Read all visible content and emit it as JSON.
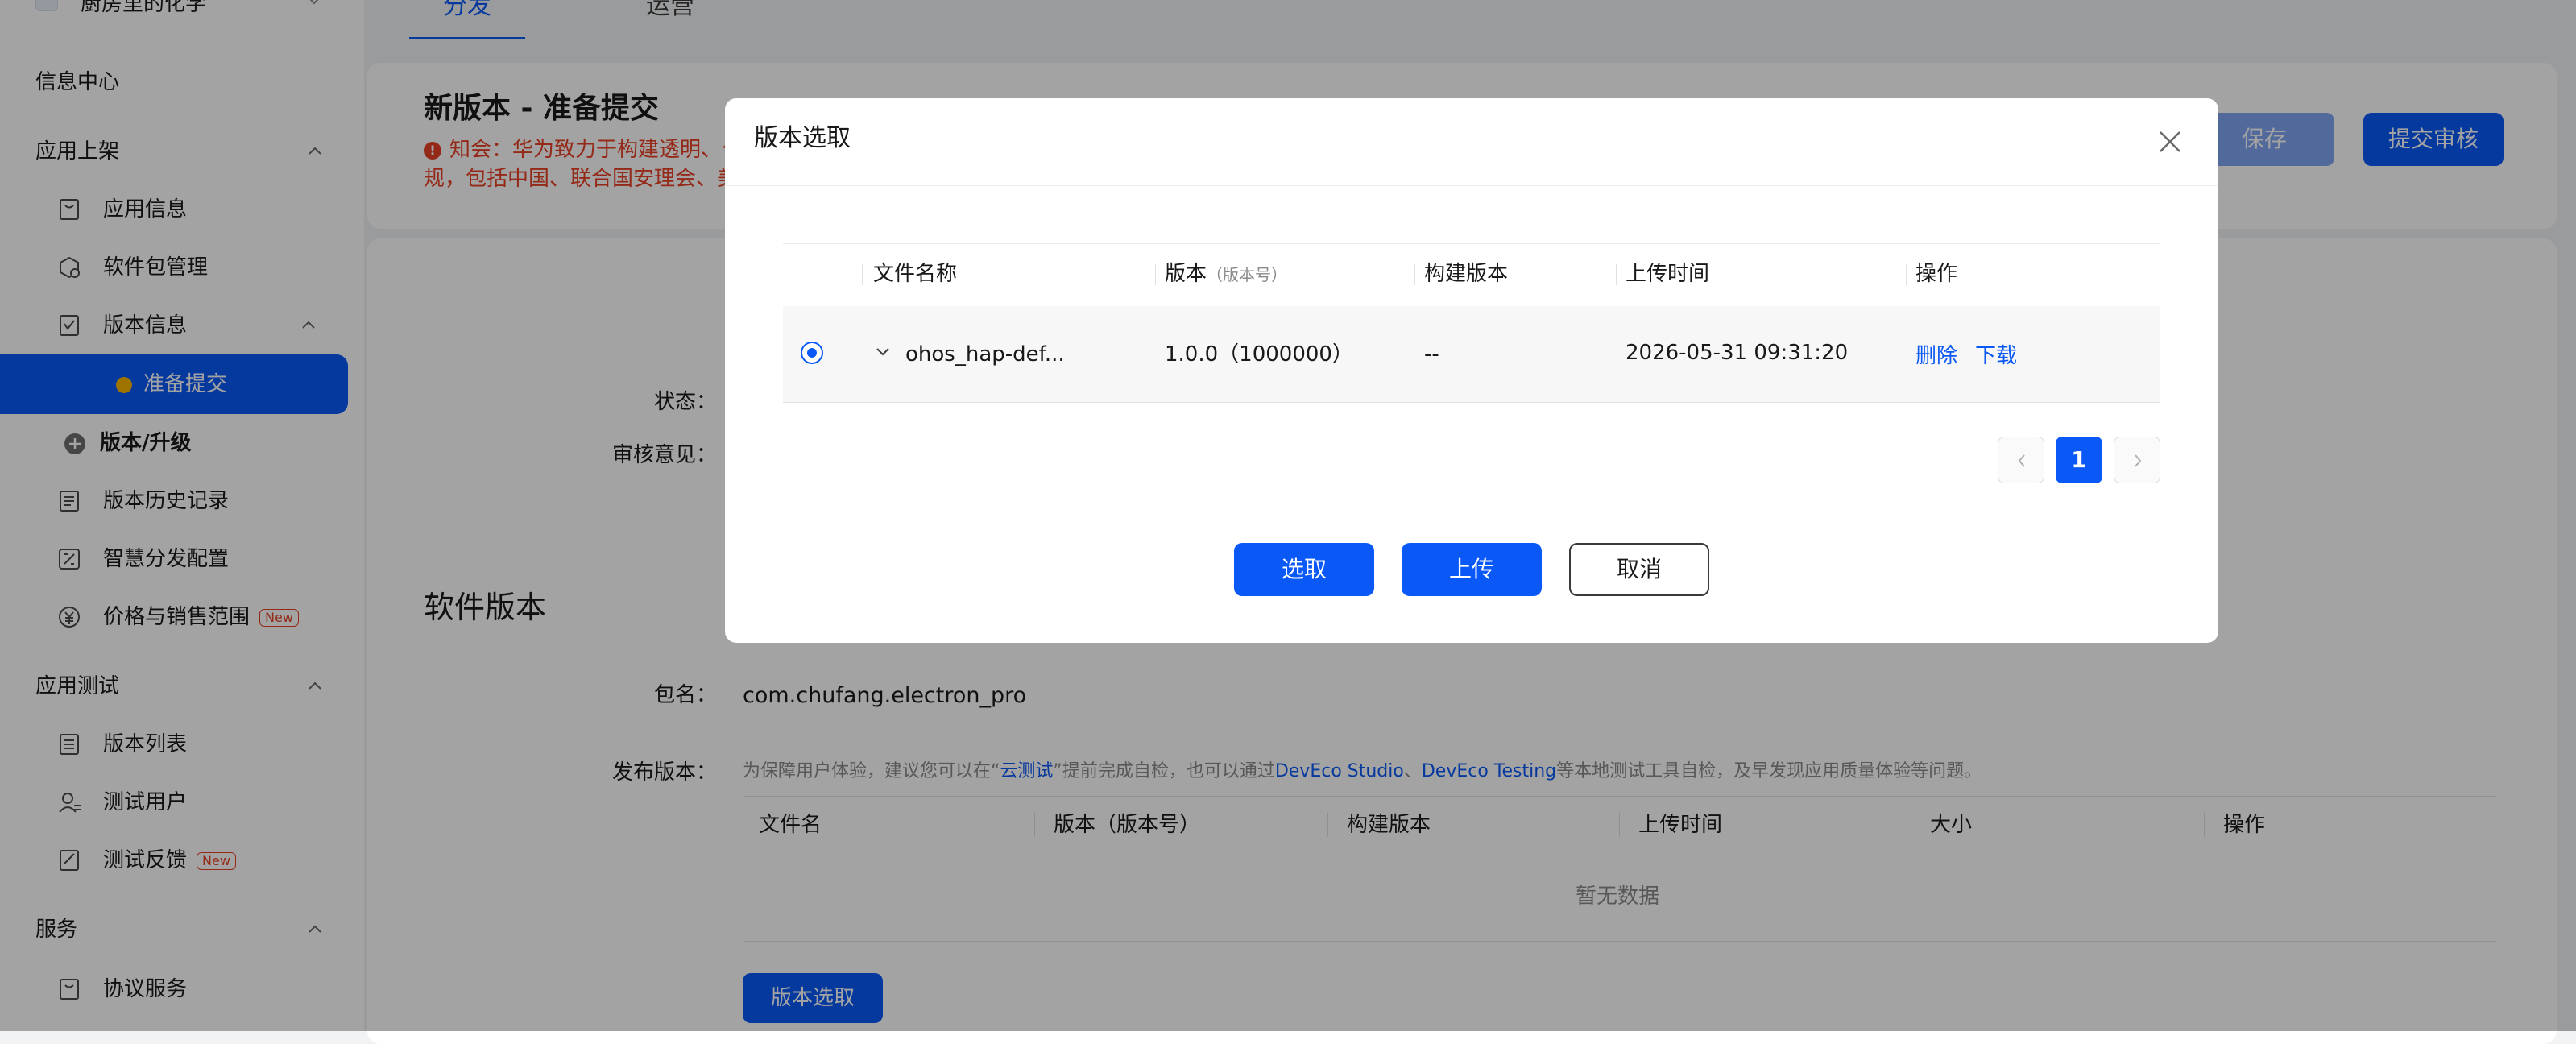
{
  "sidebar": {
    "app_name": "厨房里的化学",
    "info_center": "信息中心",
    "groups": {
      "publish": "应用上架",
      "test": "应用测试",
      "service": "服务"
    },
    "items": {
      "app_info": "应用信息",
      "package_mgmt": "软件包管理",
      "version_info": "版本信息",
      "prepare_submit": "准备提交",
      "version_upgrade": "版本/升级",
      "version_history": "版本历史记录",
      "smart_distribution": "智慧分发配置",
      "price_sales": "价格与销售范围",
      "version_list": "版本列表",
      "test_users": "测试用户",
      "test_feedback": "测试反馈",
      "agreement_service": "协议服务"
    },
    "new_badge": "New"
  },
  "tabs": {
    "distribution": "分发",
    "operation": "运营"
  },
  "header": {
    "title": "新版本 - 准备提交",
    "notice_line1": "知会：华为致力于构建透明、公",
    "notice_line2": "规，包括中国、联合国安理会、美",
    "save": "保存",
    "submit_review": "提交审核"
  },
  "form": {
    "status_label": "状态：",
    "review_label": "审核意见：",
    "software_version_title": "软件版本",
    "package_label": "包名：",
    "package_value": "com.chufang.electron_pro",
    "release_label": "发布版本：",
    "hint": {
      "part1": "为保障用户体验，建议您可以在“",
      "cloud_test": "云测试",
      "part2": "”提前完成自检，也可以通过",
      "deveco_studio": "DevEco Studio",
      "sep": "、",
      "deveco_testing": "DevEco Testing",
      "part3": "等本地测试工具自检，及早发现应用质量体验等问题。"
    },
    "table_headers": [
      "文件名",
      "版本（版本号）",
      "构建版本",
      "上传时间",
      "大小",
      "操作"
    ],
    "empty_text": "暂无数据",
    "version_select_button": "版本选取"
  },
  "modal": {
    "title": "版本选取",
    "headers": {
      "file_name": "文件名称",
      "version": "版本",
      "version_sub": "（版本号）",
      "build_version": "构建版本",
      "upload_time": "上传时间",
      "actions": "操作"
    },
    "row": {
      "file_name": "ohos_hap-def...",
      "version": "1.0.0（1000000）",
      "build_version": "--",
      "upload_time": "2026-05-31 09:31:20",
      "delete": "删除",
      "download": "下载",
      "selected": true
    },
    "pagination": {
      "current_page": "1"
    },
    "buttons": {
      "select": "选取",
      "upload": "上传",
      "cancel": "取消"
    }
  },
  "colors": {
    "primary": "#0a59f7",
    "danger": "#e84026",
    "active_dot": "#f7b500",
    "disabled_button": "#7fa7f3"
  }
}
